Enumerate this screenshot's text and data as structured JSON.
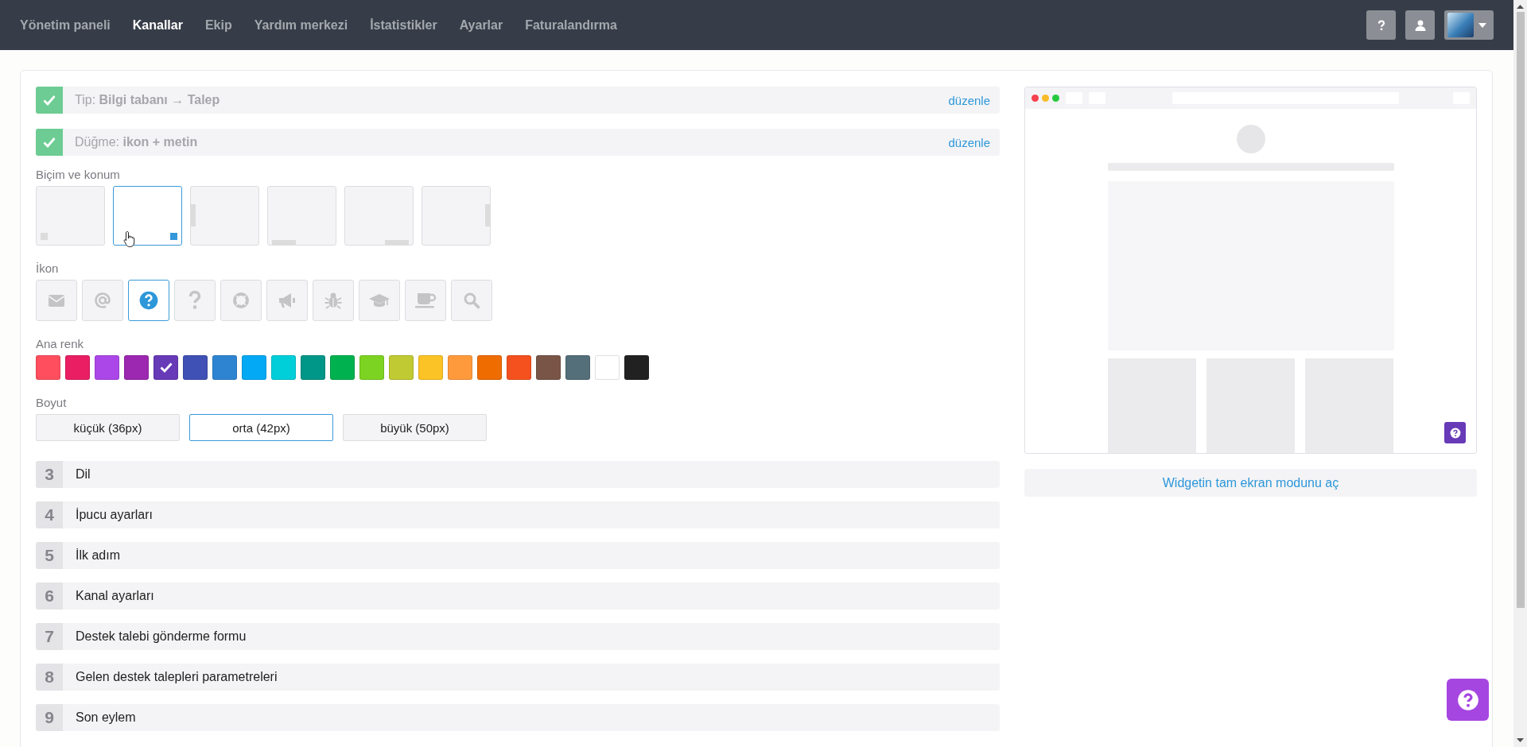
{
  "nav": {
    "items": [
      {
        "label": "Yönetim paneli",
        "selected": false
      },
      {
        "label": "Kanallar",
        "selected": true
      },
      {
        "label": "Ekip",
        "selected": false
      },
      {
        "label": "Yardım merkezi",
        "selected": false
      },
      {
        "label": "İstatistikler",
        "selected": false
      },
      {
        "label": "Ayarlar",
        "selected": false
      },
      {
        "label": "Faturalandırma",
        "selected": false
      }
    ]
  },
  "steps_done": [
    {
      "text": "Tip: **Bilgi tabanı → Talep**",
      "link": "düzenle"
    },
    {
      "text": "Düğme: **ikon + metin**",
      "link": "düzenle"
    }
  ],
  "format": {
    "label": "Biçim ve konum",
    "options": [
      {
        "kind": "corner-left",
        "selected": false
      },
      {
        "kind": "corner-right",
        "selected": true
      },
      {
        "kind": "side-left",
        "selected": false
      },
      {
        "kind": "bottom-left",
        "selected": false
      },
      {
        "kind": "bottom-right",
        "selected": false
      },
      {
        "kind": "side-right",
        "selected": false
      }
    ]
  },
  "icon": {
    "label": "İkon",
    "options": [
      {
        "kind": "envelope",
        "selected": false
      },
      {
        "kind": "at",
        "selected": false
      },
      {
        "kind": "question-circle",
        "selected": true
      },
      {
        "kind": "question",
        "selected": false
      },
      {
        "kind": "lifebuoy",
        "selected": false
      },
      {
        "kind": "megaphone",
        "selected": false
      },
      {
        "kind": "bug",
        "selected": false
      },
      {
        "kind": "cap",
        "selected": false
      },
      {
        "kind": "cup",
        "selected": false
      },
      {
        "kind": "search",
        "selected": false
      }
    ]
  },
  "color": {
    "label": "Ana renk",
    "swatches": [
      {
        "color": "#ff4f5e",
        "selected": false
      },
      {
        "color": "#e91e63",
        "selected": false
      },
      {
        "color": "#ab47e8",
        "selected": false
      },
      {
        "color": "#9c27b0",
        "selected": false
      },
      {
        "color": "#673ab7",
        "selected": true
      },
      {
        "color": "#3f51b5",
        "selected": false
      },
      {
        "color": "#2e84d0",
        "selected": false
      },
      {
        "color": "#03a9f4",
        "selected": false
      },
      {
        "color": "#00ced9",
        "selected": false
      },
      {
        "color": "#009688",
        "selected": false
      },
      {
        "color": "#00b14f",
        "selected": false
      },
      {
        "color": "#7dd321",
        "selected": false
      },
      {
        "color": "#c0ca33",
        "selected": false
      },
      {
        "color": "#fbc325",
        "selected": false
      },
      {
        "color": "#ff9a3c",
        "selected": false
      },
      {
        "color": "#ef6c00",
        "selected": false
      },
      {
        "color": "#f4511e",
        "selected": false
      },
      {
        "color": "#795548",
        "selected": false
      },
      {
        "color": "#546e7a",
        "selected": false
      },
      {
        "color": "#ffffff",
        "selected": false
      },
      {
        "color": "#212121",
        "selected": false
      }
    ]
  },
  "size": {
    "label": "Boyut",
    "options": [
      {
        "label": "küçük (36px)",
        "selected": false
      },
      {
        "label": "orta (42px)",
        "selected": true
      },
      {
        "label": "büyük (50px)",
        "selected": false
      }
    ]
  },
  "steps": [
    {
      "number": "3",
      "title": "Dil"
    },
    {
      "number": "4",
      "title": "İpucu ayarları"
    },
    {
      "number": "5",
      "title": "İlk adım"
    },
    {
      "number": "6",
      "title": "Kanal ayarları"
    },
    {
      "number": "7",
      "title": "Destek talebi gönderme formu"
    },
    {
      "number": "8",
      "title": "Gelen destek talepleri parametreleri"
    },
    {
      "number": "9",
      "title": "Son eylem"
    }
  ],
  "preview": {
    "button_label": "Widgetin tam ekran modunu aç"
  }
}
